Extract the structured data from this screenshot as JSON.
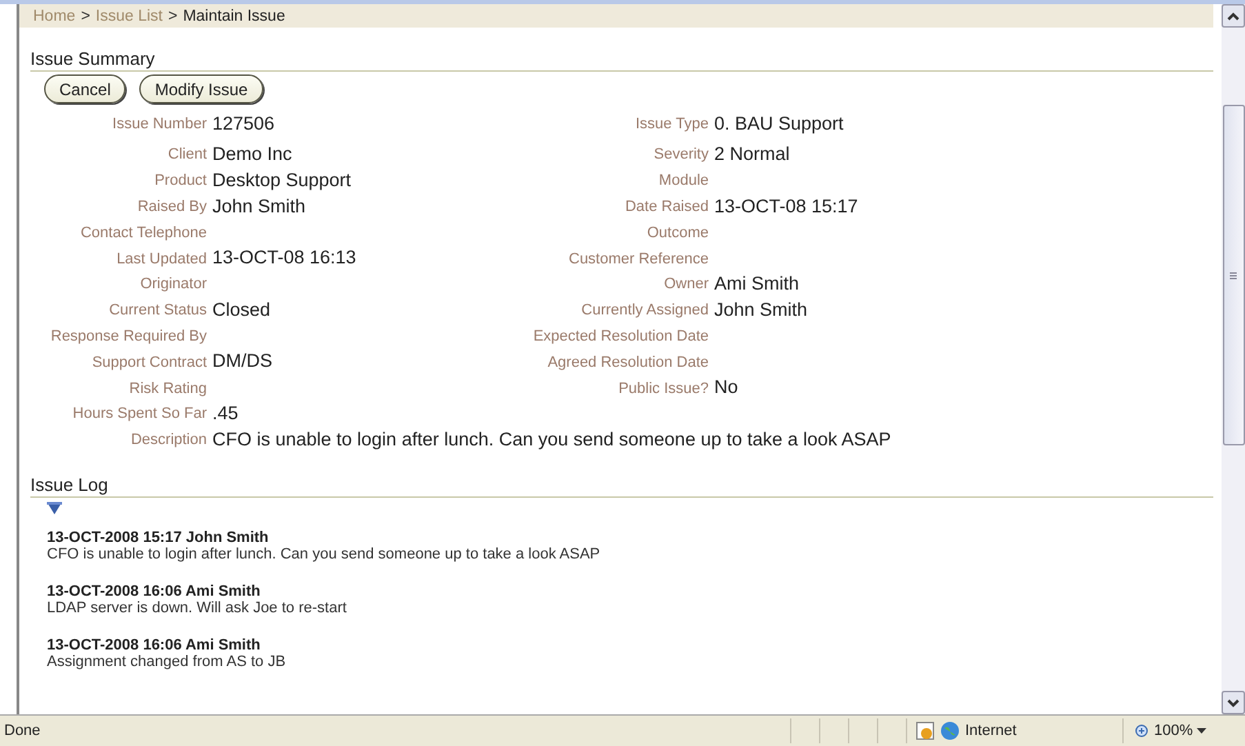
{
  "breadcrumb": {
    "separator": ">",
    "items": [
      {
        "label": "Home",
        "current": false
      },
      {
        "label": "Issue List",
        "current": false
      },
      {
        "label": "Maintain Issue",
        "current": true
      }
    ]
  },
  "summary": {
    "title": "Issue Summary",
    "buttons": [
      "Cancel",
      "Modify Issue"
    ],
    "rows": [
      [
        {
          "label": "Issue Number",
          "value": "127506"
        },
        {
          "label": "Issue Type",
          "value": "0. BAU Support"
        }
      ],
      [
        {
          "label": "Client",
          "value": "Demo Inc"
        },
        {
          "label": "Severity",
          "value": "2 Normal"
        }
      ],
      [
        {
          "label": "Product",
          "value": "Desktop Support"
        },
        {
          "label": "Module"
        }
      ],
      [
        {
          "label": "Raised By",
          "value": "John Smith"
        },
        {
          "label": "Date Raised",
          "value": "13-OCT-08 15:17"
        }
      ],
      [
        {
          "label": "Contact Telephone"
        },
        {
          "label": "Outcome"
        }
      ],
      [
        {
          "label": "Last Updated",
          "value": "13-OCT-08 16:13"
        },
        {
          "label": "Customer Reference"
        }
      ],
      [
        {
          "label": "Originator"
        },
        {
          "label": "Owner",
          "value": "Ami Smith"
        }
      ],
      [
        {
          "label": "Current Status",
          "value": "Closed"
        },
        {
          "label": "Currently Assigned",
          "value": "John Smith"
        }
      ],
      [
        {
          "label": "Response Required By"
        },
        {
          "label": "Expected Resolution Date"
        }
      ],
      [
        {
          "label": "Support Contract",
          "value": "DM/DS"
        },
        {
          "label": "Agreed Resolution Date"
        }
      ],
      [
        {
          "label": "Risk Rating"
        },
        {
          "label": "Public Issue?",
          "value": "No"
        }
      ],
      [
        {
          "label": "Hours Spent So Far",
          "value": ".45"
        }
      ]
    ],
    "description": {
      "label": "Description",
      "value": "CFO is unable to login after lunch. Can you send someone up to take a look ASAP"
    }
  },
  "log": {
    "title": "Issue Log",
    "entries": [
      {
        "header": "13-OCT-2008 15:17 John Smith",
        "text": "CFO is unable to login after lunch. Can you send someone up to take a look ASAP"
      },
      {
        "header": "13-OCT-2008 16:06 Ami Smith",
        "text": "LDAP server is down. Will ask Joe to re-start"
      },
      {
        "header": "13-OCT-2008 16:06 Ami Smith",
        "text": "Assignment changed from AS to JB"
      }
    ]
  },
  "status_bar": {
    "status": "Done",
    "zone": "Internet",
    "zoom": "100%"
  }
}
